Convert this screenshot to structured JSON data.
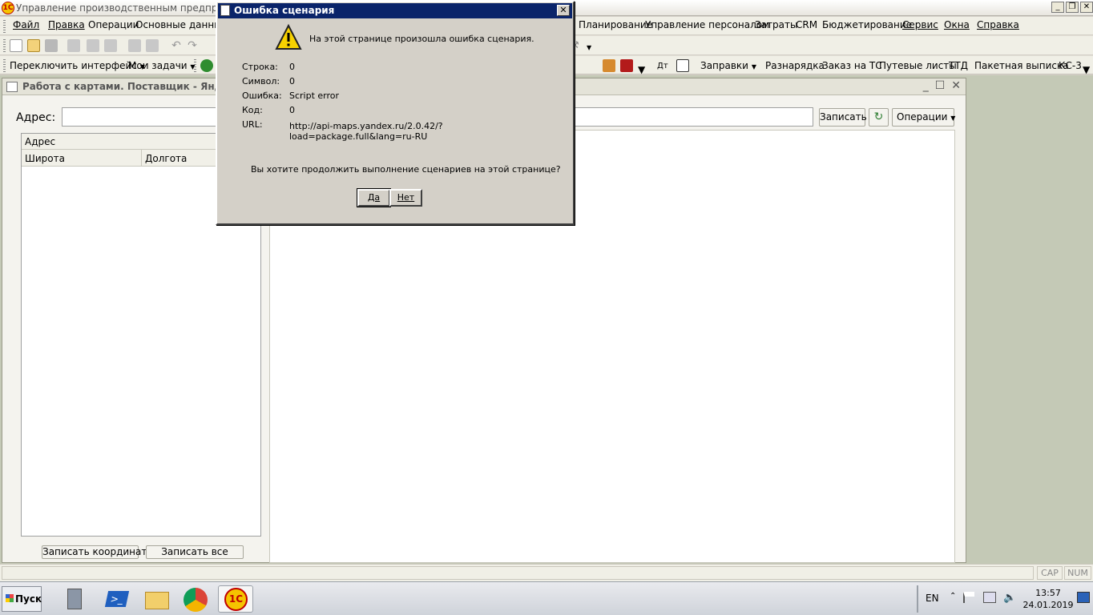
{
  "app": {
    "title": "Управление производственным предприятием",
    "logo": "1С"
  },
  "menu": {
    "left": [
      "Файл",
      "Правка",
      "Операции",
      "Основные данные"
    ],
    "right": [
      "Планирование",
      "Управление персоналом",
      "Затраты",
      "CRM",
      "Бюджетирование",
      "Сервис",
      "Окна",
      "Справка"
    ]
  },
  "toolbar2": {
    "left": [
      "Переключить интерфейс",
      "Мои задачи"
    ],
    "dt_label": "Дт",
    "right": [
      "Заправки",
      "Разнарядка",
      "Заказ на ТС",
      "Путевые листы",
      "ТТД",
      "Пакетная выписка",
      "КС-3"
    ]
  },
  "child_window": {
    "title": "Работа с картами. Поставщик - Яндекс",
    "address_label": "Адрес:",
    "address_value": "",
    "save_button": "Записать",
    "refresh_icon": "↻",
    "operations_button": "Операции",
    "grid": {
      "group_header": "Адрес",
      "columns": [
        "Широта",
        "Долгота"
      ]
    },
    "save_coords_button": "Записать координаты",
    "save_all_button": "Записать все"
  },
  "status": {
    "cap": "CAP",
    "num": "NUM"
  },
  "taskbar": {
    "start_label": "Пуск",
    "lang": "EN",
    "time": "13:57",
    "date": "24.01.2019"
  },
  "dialog": {
    "title": "Ошибка сценария",
    "message": "На этой странице произошла ошибка сценария.",
    "fields": [
      {
        "label": "Строка:",
        "value": "0"
      },
      {
        "label": "Символ:",
        "value": "0"
      },
      {
        "label": "Ошибка:",
        "value": "Script error"
      },
      {
        "label": "Код:",
        "value": "0"
      }
    ],
    "url_label": "URL:",
    "url_value": "http://api-maps.yandex.ru/2.0.42/?load=package.full&lang=ru-RU",
    "question": "Вы хотите продолжить выполнение сценариев на этой странице?",
    "yes_button": "Да",
    "no_button": "Нет"
  },
  "colors": {
    "dialog_title_bg": "#0a246a",
    "workspace_bg": "#c4c9b6",
    "warning_yellow": "#f7d200"
  }
}
